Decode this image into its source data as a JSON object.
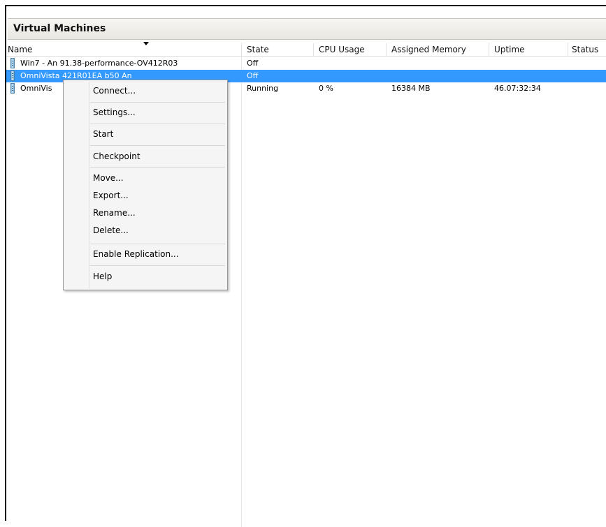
{
  "panel": {
    "title": "Virtual Machines"
  },
  "columns": {
    "name": "Name",
    "state": "State",
    "cpu": "CPU Usage",
    "memory": "Assigned Memory",
    "uptime": "Uptime",
    "status": "Status"
  },
  "rows": [
    {
      "name": "Win7 - An 91.38-performance-OV412R03",
      "state": "Off",
      "cpu": "",
      "memory": "",
      "uptime": "",
      "status": ""
    },
    {
      "name": "OmniVista 421R01EA b50 An",
      "state": "Off",
      "cpu": "",
      "memory": "",
      "uptime": "",
      "status": "",
      "selected": true
    },
    {
      "name": "OmniVis",
      "state": "Running",
      "cpu": "0 %",
      "memory": "16384 MB",
      "uptime": "46.07:32:34",
      "status": ""
    }
  ],
  "context_menu": {
    "items": [
      "Connect...",
      "Settings...",
      "Start",
      "Checkpoint",
      "Move...",
      "Export...",
      "Rename...",
      "Delete...",
      "Enable Replication...",
      "Help"
    ]
  },
  "colors": {
    "selection": "#3399ff",
    "header_bg": "#ece9e2"
  }
}
